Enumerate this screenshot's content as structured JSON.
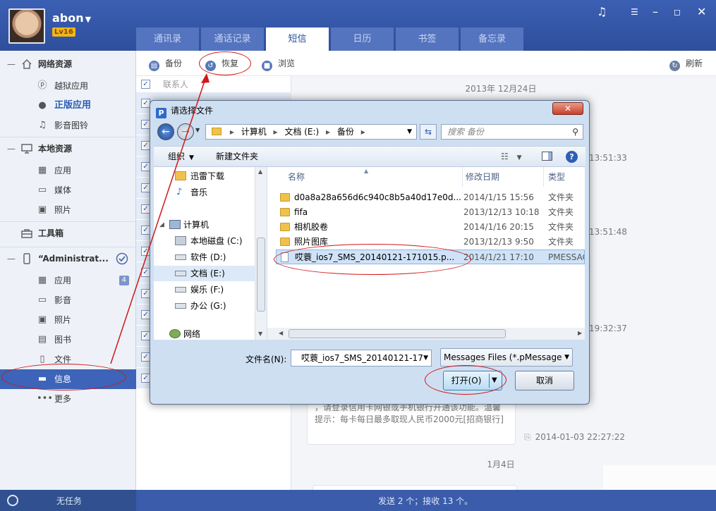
{
  "header": {
    "username": "abon",
    "level": "Lv16",
    "tabs": [
      "通讯录",
      "通话记录",
      "短信",
      "日历",
      "书签",
      "备忘录"
    ],
    "active_tab": 2
  },
  "sidebar": {
    "net_section": "网络资源",
    "net_items": [
      "越狱应用",
      "正版应用",
      "影音图铃"
    ],
    "local_section": "本地资源",
    "local_items": [
      "应用",
      "媒体",
      "照片"
    ],
    "toolbox": "工具箱",
    "device_section": "“Administrat...",
    "device_items": [
      "应用",
      "影音",
      "照片",
      "图书",
      "文件",
      "信息",
      "更多"
    ],
    "app_badge": "4"
  },
  "toolbar": {
    "backup": "备份",
    "restore": "恢复",
    "browse": "浏览",
    "refresh": "刷新"
  },
  "list": {
    "header": "联系人"
  },
  "conversation": {
    "date1": "2013年 12月24日",
    "times": [
      "13:51:33",
      "13:51:48",
      "19:32:37"
    ],
    "bubble_text": "，请登录信用卡网银或手机银行开通该功能。温馨提示：每卡每日最多取现人民币2000元[招商银行]",
    "bubble_time": "2014-01-03 22:27:22",
    "date2": "1月4日"
  },
  "status": {
    "task": "无任务",
    "summary": "发送 2 个；接收 13 个。"
  },
  "dialog": {
    "title": "请选择文件",
    "path": [
      "计算机",
      "文档 (E:)",
      "备份"
    ],
    "search_placeholder": "搜索 备份",
    "cmd_organize": "组织",
    "cmd_new_folder": "新建文件夹",
    "nav": [
      "迅雷下载",
      "音乐",
      "计算机",
      "本地磁盘 (C:)",
      "软件 (D:)",
      "文档 (E:)",
      "娱乐 (F:)",
      "办公 (G:)",
      "网络"
    ],
    "columns": {
      "name": "名称",
      "date": "修改日期",
      "type": "类型"
    },
    "files": [
      {
        "name": "d0a8a28a656d6c940c8b5a40d17e0d...",
        "date": "2014/1/15 15:56",
        "type": "文件夹",
        "kind": "folder"
      },
      {
        "name": "fifa",
        "date": "2013/12/13 10:18",
        "type": "文件夹",
        "kind": "folder"
      },
      {
        "name": "相机胶卷",
        "date": "2014/1/16 20:15",
        "type": "文件夹",
        "kind": "folder"
      },
      {
        "name": "照片图库",
        "date": "2013/12/13 9:50",
        "type": "文件夹",
        "kind": "folder"
      },
      {
        "name": "哎蓑_ios7_SMS_20140121-171015.p...",
        "date": "2014/1/21 17:10",
        "type": "PMESSAGE",
        "kind": "file"
      }
    ],
    "filename_label": "文件名(N):",
    "filename_value": "哎蓑_ios7_SMS_20140121-17",
    "filetype": "Messages Files (*.pMessage",
    "open": "打开(O)",
    "cancel": "取消"
  },
  "colors": {
    "header_blue": "#3b5fb3",
    "selected_blue": "#3d64b8",
    "annotation_red": "#d01818"
  }
}
